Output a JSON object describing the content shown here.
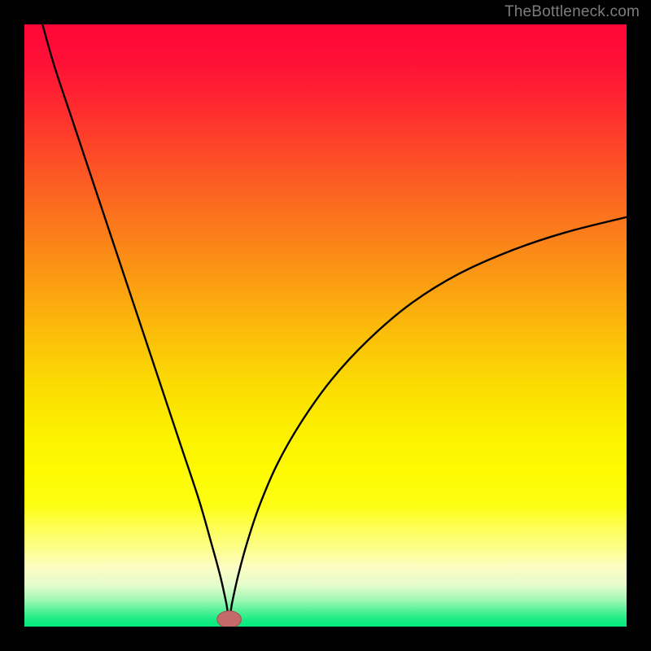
{
  "attribution": "TheBottleneck.com",
  "colors": {
    "frame": "#000000",
    "attribution_text": "#7d7d7d",
    "curve": "#000000",
    "marker_fill": "#c46a6a",
    "marker_stroke": "#a84d4d",
    "gradient_stops": [
      {
        "offset": 0.0,
        "color": "#ff0637"
      },
      {
        "offset": 0.06,
        "color": "#ff1036"
      },
      {
        "offset": 0.12,
        "color": "#fe2431"
      },
      {
        "offset": 0.2,
        "color": "#fd4429"
      },
      {
        "offset": 0.28,
        "color": "#fc6421"
      },
      {
        "offset": 0.36,
        "color": "#fb8319"
      },
      {
        "offset": 0.44,
        "color": "#fba211"
      },
      {
        "offset": 0.52,
        "color": "#fbc009"
      },
      {
        "offset": 0.6,
        "color": "#fbdc02"
      },
      {
        "offset": 0.68,
        "color": "#fcf100"
      },
      {
        "offset": 0.74,
        "color": "#fdfa01"
      },
      {
        "offset": 0.8,
        "color": "#fdfe15"
      },
      {
        "offset": 0.83,
        "color": "#fdfe4d"
      },
      {
        "offset": 0.87,
        "color": "#fdfe8b"
      },
      {
        "offset": 0.9,
        "color": "#fdfdc2"
      },
      {
        "offset": 0.93,
        "color": "#e7fccc"
      },
      {
        "offset": 0.955,
        "color": "#a3f8b5"
      },
      {
        "offset": 0.975,
        "color": "#4ef095"
      },
      {
        "offset": 0.99,
        "color": "#14eb82"
      },
      {
        "offset": 1.0,
        "color": "#02ea7d"
      }
    ]
  },
  "chart_data": {
    "type": "line",
    "title": "",
    "xlabel": "",
    "ylabel": "",
    "x_range": [
      0,
      100
    ],
    "y_range": [
      0,
      100
    ],
    "notch_x": 34,
    "marker": {
      "x": 34,
      "y": 1.2,
      "rx": 2.0,
      "ry": 1.4
    },
    "series": [
      {
        "name": "bottleneck-curve",
        "x": [
          3,
          5,
          8,
          11,
          14,
          17,
          20,
          23,
          26,
          29,
          31,
          32.5,
          33.5,
          34,
          34.5,
          35.5,
          37,
          39,
          42,
          46,
          51,
          57,
          64,
          72,
          81,
          90,
          100
        ],
        "y": [
          100,
          93,
          84,
          75,
          66,
          57,
          48,
          39,
          30,
          21,
          14,
          8.5,
          4.0,
          1.3,
          4.0,
          8.5,
          14,
          20,
          27,
          34,
          41,
          47.5,
          53.5,
          58.5,
          62.5,
          65.5,
          68
        ]
      }
    ]
  }
}
